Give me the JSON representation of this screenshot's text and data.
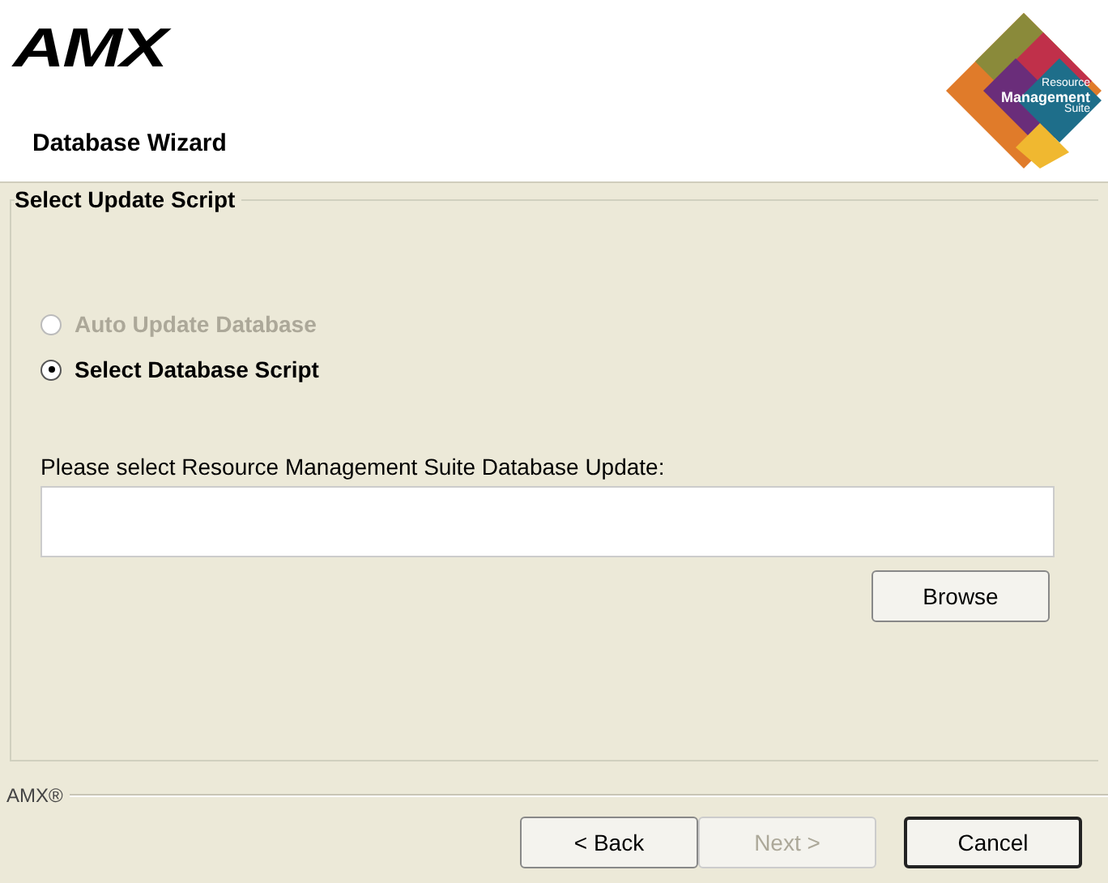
{
  "header": {
    "brand": "AMX",
    "title": "Database Wizard",
    "product_logo": {
      "lines": [
        "Resource",
        "Management",
        "Suite"
      ]
    }
  },
  "group": {
    "title": "Select Update Script",
    "options": [
      {
        "label": "Auto Update Database",
        "selected": false,
        "disabled": true
      },
      {
        "label": "Select Database Script",
        "selected": true,
        "disabled": false
      }
    ],
    "field_label": "Please select Resource Management Suite Database Update:",
    "browse_button": {
      "label": "Browse",
      "disabled": false
    }
  },
  "footer": {
    "brand": "AMX®",
    "buttons": [
      {
        "label": "< Back",
        "disabled": false,
        "default": false
      },
      {
        "label": "Next >",
        "disabled": true,
        "default": false
      },
      {
        "label": "Cancel",
        "disabled": false,
        "default": true
      }
    ]
  }
}
